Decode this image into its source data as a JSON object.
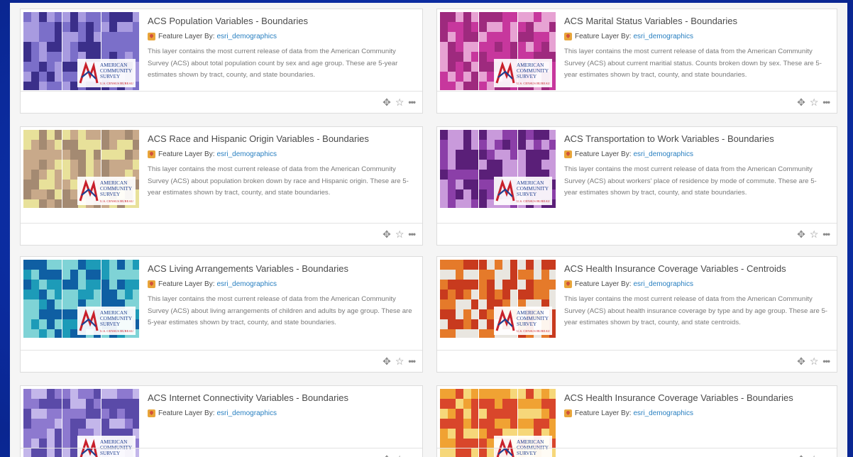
{
  "items": [
    {
      "title": "ACS Population Variables - Boundaries",
      "type_label": "Feature Layer By:",
      "author": "esri_demographics",
      "description": "This layer contains the most current release of data from the American Community Survey (ACS) about total population count by sex and age group. These are 5-year estimates shown by tract, county, and state boundaries.",
      "palette": [
        "#7b6fc9",
        "#3b2f8a",
        "#a89be0"
      ]
    },
    {
      "title": "ACS Marital Status Variables - Boundaries",
      "type_label": "Feature Layer By:",
      "author": "esri_demographics",
      "description": "This layer contains the most current release of data from the American Community Survey (ACS) about current maritial status. Counts broken down by sex. These are 5-year estimates shown by tract, county, and state boundaries.",
      "palette": [
        "#c7379d",
        "#e7a2d3",
        "#9e2a7e"
      ]
    },
    {
      "title": "ACS Race and Hispanic Origin Variables - Boundaries",
      "type_label": "Feature Layer By:",
      "author": "esri_demographics",
      "description": "This layer contains the most current release of data from the American Community Survey (ACS) about population broken down by race and Hispanic origin. These are 5-year estimates shown by tract, county, and state boundaries.",
      "palette": [
        "#c8a98a",
        "#a48a72",
        "#e8e19a"
      ]
    },
    {
      "title": "ACS Transportation to Work Variables - Boundaries",
      "type_label": "Feature Layer By:",
      "author": "esri_demographics",
      "description": "This layer contains the most current release of data from the American Community Survey (ACS) about workers' place of residence by mode of commute. These are 5-year estimates shown by tract, county, and state boundaries.",
      "palette": [
        "#8b3fa8",
        "#c99adb",
        "#5a1f78"
      ]
    },
    {
      "title": "ACS Living Arrangements Variables - Boundaries",
      "type_label": "Feature Layer By:",
      "author": "esri_demographics",
      "description": "This layer contains the most current release of data from the American Community Survey (ACS) about living arrangements of children and adults by age group. These are 5-year estimates shown by tract, county, and state boundaries.",
      "palette": [
        "#1d9bb8",
        "#0f5fa3",
        "#7fd3d6"
      ]
    },
    {
      "title": "ACS Health Insurance Coverage Variables - Centroids",
      "type_label": "Feature Layer By:",
      "author": "esri_demographics",
      "description": "This layer contains the most current release of data from the American Community Survey (ACS) about health insurance coverage by type and by age group. These are 5-year estimates shown by tract, county, and state centroids.",
      "palette": [
        "#e9e6e0",
        "#e57a2a",
        "#c83a1e"
      ]
    },
    {
      "title": "ACS Internet Connectivity Variables - Boundaries",
      "type_label": "Feature Layer By:",
      "author": "esri_demographics",
      "description": "",
      "palette": [
        "#8d79cf",
        "#c3b6ea",
        "#5a4aa8"
      ]
    },
    {
      "title": "ACS Health Insurance Coverage Variables - Boundaries",
      "type_label": "Feature Layer By:",
      "author": "esri_demographics",
      "description": "",
      "palette": [
        "#f0a233",
        "#d9462b",
        "#f6d77a"
      ]
    }
  ],
  "logo": {
    "line1": "AMERICAN",
    "line2": "COMMUNITY",
    "line3": "SURVEY",
    "line4": "U.S. CENSUS BUREAU"
  },
  "icons": {
    "open": "move-icon",
    "favorite": "star-icon",
    "more": "more-options-icon"
  }
}
